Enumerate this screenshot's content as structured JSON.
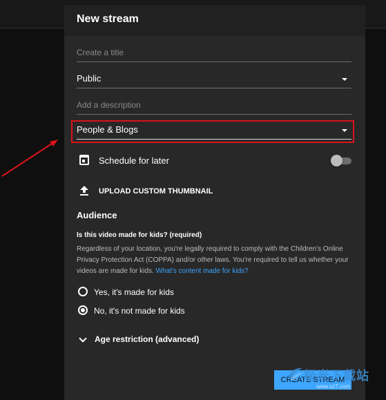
{
  "dialog": {
    "title": "New stream",
    "title_field": {
      "placeholder": "Create a title"
    },
    "visibility": {
      "value": "Public"
    },
    "description_field": {
      "placeholder": "Add a description"
    },
    "category": {
      "value": "People & Blogs"
    },
    "schedule": {
      "label": "Schedule for later",
      "enabled": false
    },
    "upload_thumbnail": {
      "label": "UPLOAD CUSTOM THUMBNAIL"
    },
    "audience": {
      "title": "Audience",
      "question": "Is this video made for kids? (required)",
      "body": "Regardless of your location, you're legally required to comply with the Children's Online Privacy Protection Act (COPPA) and/or other laws. You're required to tell us whether your videos are made for kids.",
      "link": "What's content made for kids?",
      "options": [
        {
          "label": "Yes, it's made for kids",
          "selected": false
        },
        {
          "label": "No, it's not made for kids",
          "selected": true
        }
      ]
    },
    "age_restriction": {
      "label": "Age restriction (advanced)"
    },
    "create_button": {
      "label": "CREATE STREAM"
    }
  },
  "watermark": {
    "text": "极光下载站",
    "sub": "www.xz7.com"
  },
  "colors": {
    "accent": "#3ea6ff",
    "highlight": "#d9131a",
    "dialog_bg": "#282828"
  }
}
